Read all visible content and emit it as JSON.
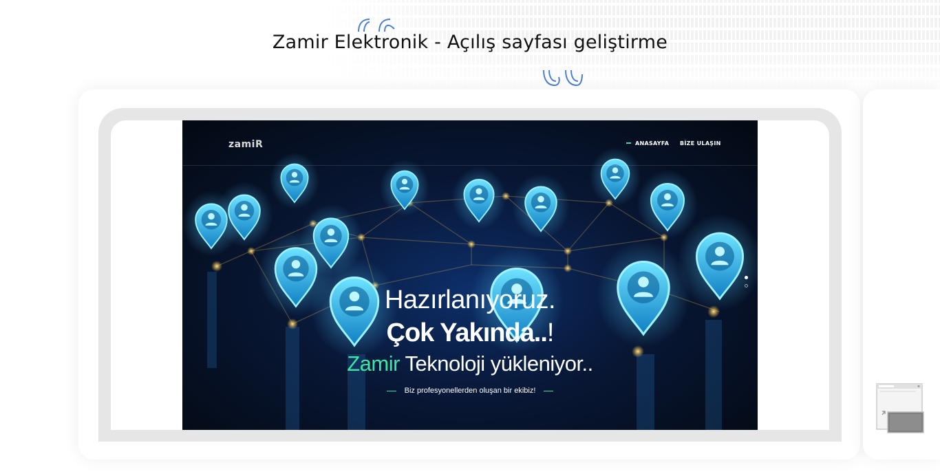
{
  "header": {
    "title": "Zamir Elektronik - Açılış sayfası geliştirme"
  },
  "site": {
    "logo": "zamiR",
    "nav": [
      {
        "label": "ANASAYFA",
        "active": true
      },
      {
        "label": "BİZE ULAŞIN",
        "active": false
      }
    ],
    "hero": {
      "line1": "Hazırlanıyoruz.",
      "line2_bold": "Çok Yakında..",
      "line2_rest": "!",
      "line3_accent": "Zamir",
      "line3_rest": " Teknoloji yükleniyor..",
      "tagline": "Biz profesyonellerden oluşan bir ekibiz!"
    },
    "slider": {
      "count": 2,
      "active_index": 0
    }
  },
  "colors": {
    "accent_green": "#3ee6a4",
    "pin_blue": "#29b6f6",
    "node_gold": "#f5b73b",
    "quote_blue": "#4a7fd0"
  },
  "icons": [
    "quote-open-icon",
    "quote-close-icon",
    "location-pin-icon",
    "browser-thumbnail-icon"
  ]
}
